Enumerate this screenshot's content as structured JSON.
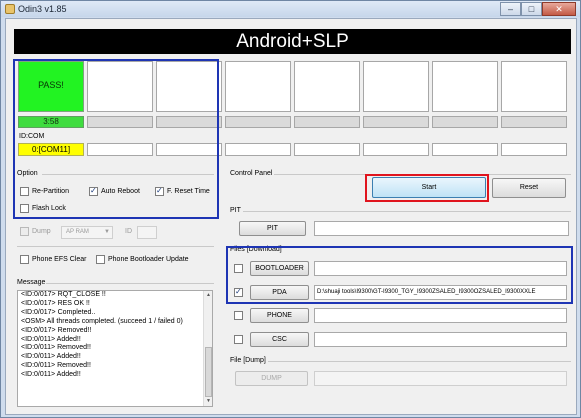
{
  "window": {
    "title": "Odin3 v1.85",
    "buttons": {
      "minimize": "–",
      "maximize": "□",
      "close": "✕"
    }
  },
  "banner": "Android+SLP",
  "slots": [
    {
      "status": "PASS!",
      "progress": "3:58",
      "com": "0:[COM11]",
      "passed": true
    },
    {
      "status": "",
      "progress": "",
      "com": ""
    },
    {
      "status": "",
      "progress": "",
      "com": ""
    },
    {
      "status": "",
      "progress": "",
      "com": ""
    },
    {
      "status": "",
      "progress": "",
      "com": ""
    },
    {
      "status": "",
      "progress": "",
      "com": ""
    },
    {
      "status": "",
      "progress": "",
      "com": ""
    },
    {
      "status": "",
      "progress": "",
      "com": ""
    }
  ],
  "id_com_label": "ID:COM",
  "option": {
    "title": "Option",
    "re_partition": {
      "label": "Re-Partition",
      "checked": false
    },
    "auto_reboot": {
      "label": "Auto Reboot",
      "checked": true
    },
    "f_reset_time": {
      "label": "F. Reset Time",
      "checked": true
    },
    "flash_lock": {
      "label": "Flash Lock",
      "checked": false
    },
    "dump": {
      "label": "Dump",
      "checked": false,
      "select_value": "AP RAM"
    },
    "id_label": "ID",
    "phone_efs_clear": {
      "label": "Phone EFS Clear",
      "checked": false
    },
    "phone_bootloader_update": {
      "label": "Phone Bootloader Update",
      "checked": false
    }
  },
  "control_panel": {
    "title": "Control Panel",
    "start": "Start",
    "reset": "Reset"
  },
  "pit": {
    "title": "PIT",
    "button": "PIT"
  },
  "files": {
    "title": "Files [Download]",
    "bootloader": {
      "label": "BOOTLOADER",
      "checked": false,
      "path": ""
    },
    "pda": {
      "label": "PDA",
      "checked": true,
      "path": "D:\\shuaji tools\\I9300\\GT-I9300_TGY_I9300ZSALED_I9300OZSALED_I9300XXLE"
    },
    "phone": {
      "label": "PHONE",
      "checked": false,
      "path": ""
    },
    "csc": {
      "label": "CSC",
      "checked": false,
      "path": ""
    }
  },
  "message": {
    "title": "Message",
    "lines": [
      "<ID:0/017> RQT_CLOSE !!",
      "<ID:0/017> RES OK !!",
      "<ID:0/017> Completed..",
      "<OSM> All threads completed. (succeed 1 / failed 0)",
      "<ID:0/017> Removed!!",
      "<ID:0/011> Added!!",
      "<ID:0/011> Removed!!",
      "<ID:0/011> Added!!",
      "<ID:0/011> Removed!!",
      "<ID:0/011> Added!!"
    ]
  },
  "file_dump": {
    "title": "File [Dump]",
    "button": "DUMP"
  },
  "colors": {
    "pass": "#22f322",
    "com_active": "#ffff00",
    "highlight_blue": "#1e35b4",
    "highlight_red": "#e0141e",
    "banner": "#000000"
  }
}
